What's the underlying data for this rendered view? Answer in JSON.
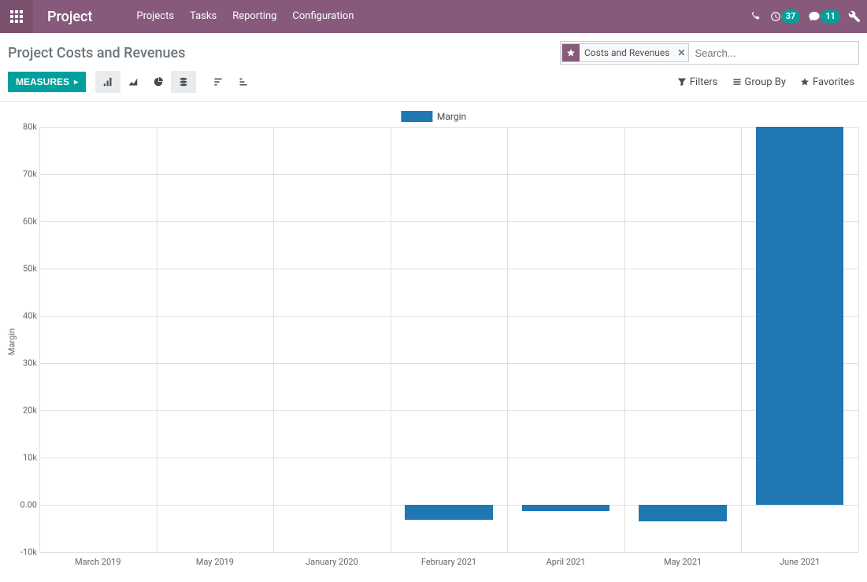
{
  "navbar": {
    "brand": "Project",
    "menu": [
      "Projects",
      "Tasks",
      "Reporting",
      "Configuration"
    ],
    "clock_badge": "37",
    "messaging_badge": "11"
  },
  "breadcrumb": "Project Costs and Revenues",
  "search": {
    "facet_label": "Costs and Revenues",
    "placeholder": "Search..."
  },
  "controls": {
    "measures_label": "MEASURES",
    "filters_label": "Filters",
    "groupby_label": "Group By",
    "favorites_label": "Favorites"
  },
  "chart_data": {
    "type": "bar",
    "title": "",
    "legend": "Margin",
    "ylabel": "Margin",
    "xlabel": "",
    "ylim": [
      -10000,
      80000
    ],
    "y_ticks": [
      -10000,
      0,
      10000,
      20000,
      30000,
      40000,
      50000,
      60000,
      70000,
      80000
    ],
    "y_tick_labels": [
      "-10k",
      "0.00",
      "10k",
      "20k",
      "30k",
      "40k",
      "50k",
      "60k",
      "70k",
      "80k"
    ],
    "categories": [
      "March 2019",
      "May 2019",
      "January 2020",
      "February 2021",
      "April 2021",
      "May 2021",
      "June 2021"
    ],
    "values": [
      0,
      0,
      0,
      -3200,
      -1300,
      -3500,
      80000
    ]
  }
}
